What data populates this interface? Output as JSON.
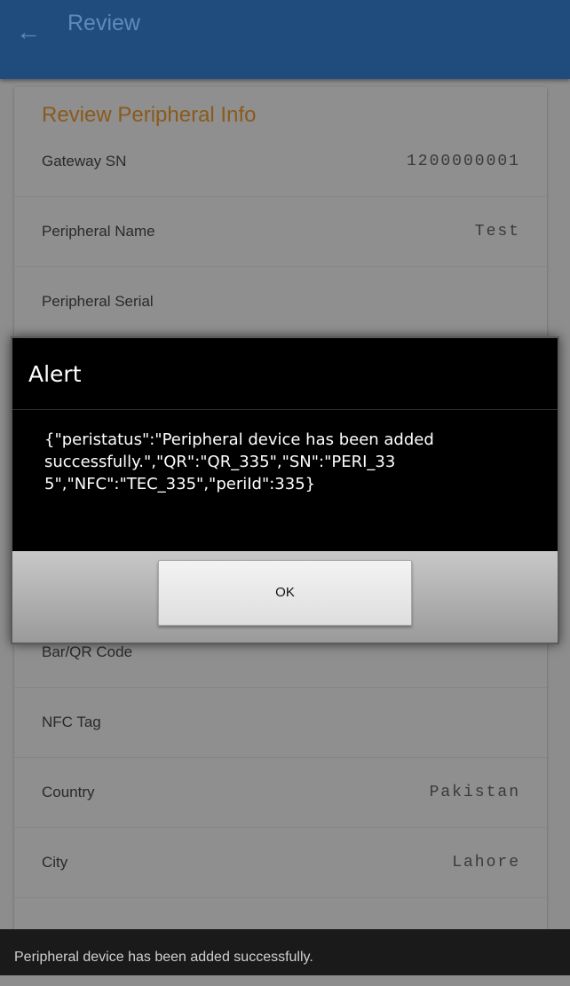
{
  "appbar": {
    "title": "Review",
    "back_icon": "arrow-left-icon"
  },
  "card": {
    "title": "Review Peripheral Info",
    "rows": [
      {
        "label": "Gateway SN",
        "value": "1200000001"
      },
      {
        "label": "Peripheral Name",
        "value": "Test"
      },
      {
        "label": "Peripheral Serial",
        "value": ""
      },
      {
        "label": "Bar/QR Code",
        "value": ""
      },
      {
        "label": "NFC Tag",
        "value": ""
      },
      {
        "label": "Country",
        "value": "Pakistan"
      },
      {
        "label": "City",
        "value": "Lahore"
      }
    ]
  },
  "dialog": {
    "title": "Alert",
    "message": "{\"peristatus\":\"Peripheral device has been added successfully.\",\"QR\":\"QR_335\",\"SN\":\"PERI_335\",\"NFC\":\"TEC_335\",\"periId\":335}",
    "ok_label": "OK"
  },
  "toast": {
    "text": "Peripheral device has been added successfully."
  }
}
